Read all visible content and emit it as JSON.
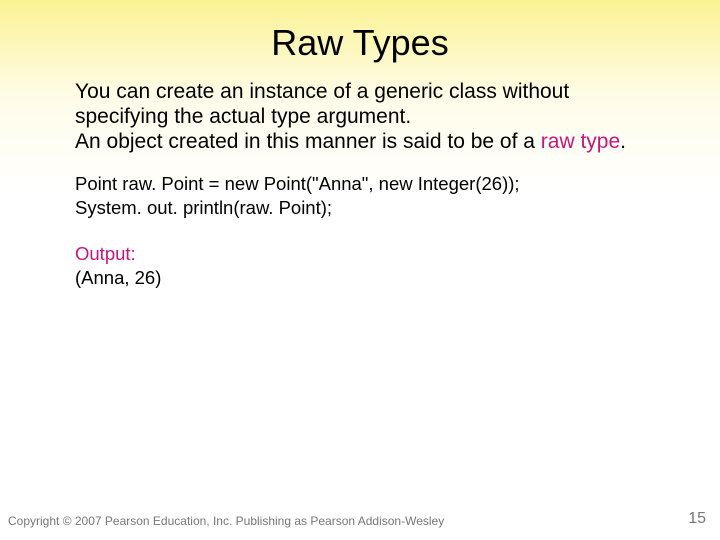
{
  "slide": {
    "title": "Raw Types",
    "para1_a": "You can create an instance of a generic class without specifying the actual type argument.",
    "para1_b": "An object created in this manner is said to be of a ",
    "para1_accent": "raw type",
    "para1_c": ".",
    "code_line1": "Point raw. Point = new Point(\"Anna\", new Integer(26));",
    "code_line2": "System. out. println(raw. Point);",
    "output_label": "Output:",
    "output_value": "(Anna, 26)",
    "footer": "Copyright © 2007 Pearson Education, Inc. Publishing as Pearson Addison-Wesley",
    "page_number": "15"
  }
}
